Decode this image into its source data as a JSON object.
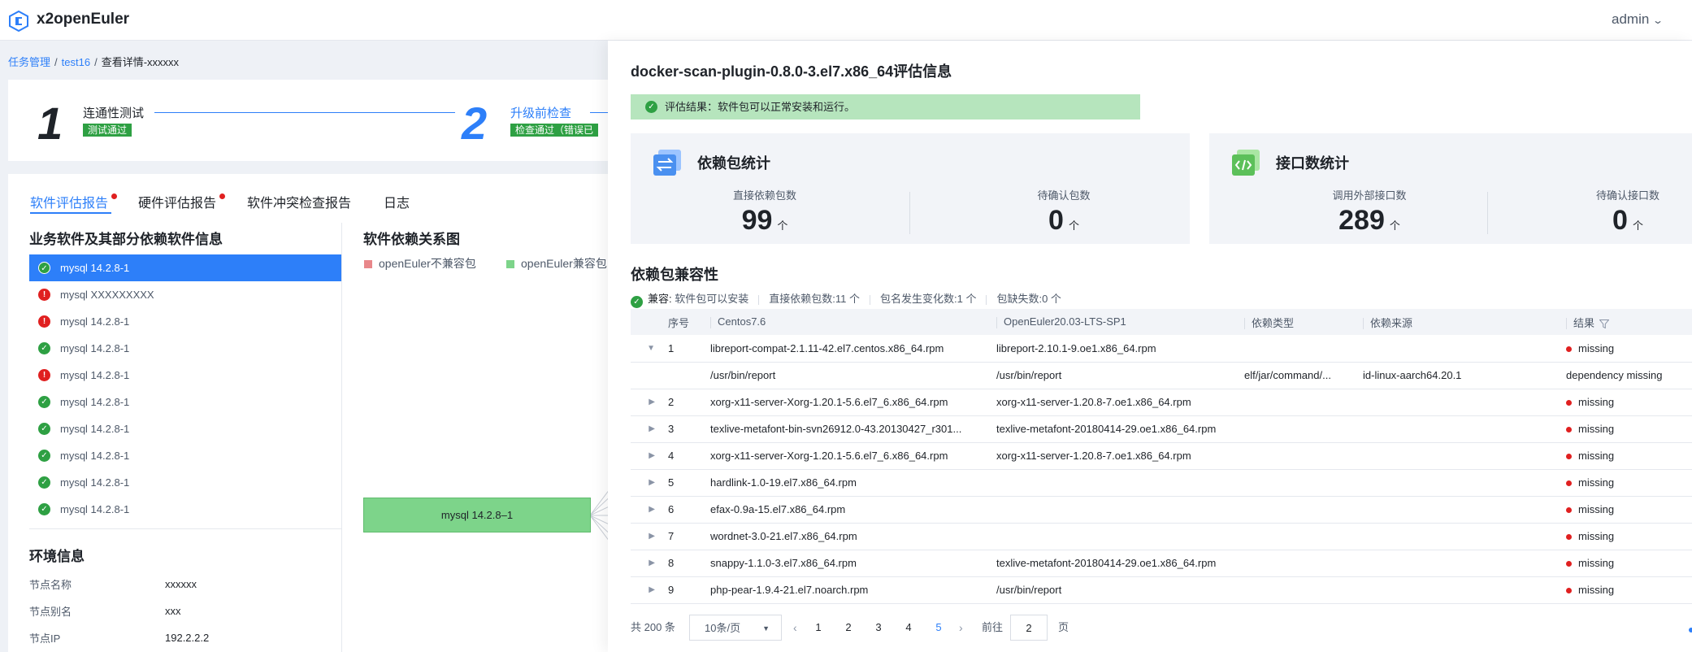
{
  "app": {
    "title": "x2openEuler",
    "user": "admin"
  },
  "breadcrumb": {
    "items": [
      "任务管理",
      "test16"
    ],
    "current": "查看详情-xxxxxx"
  },
  "steps": [
    {
      "number": "1",
      "title": "连通性测试",
      "badge": "测试通过"
    },
    {
      "number": "2",
      "title": "升级前检查",
      "badge": "检查通过（错误已"
    }
  ],
  "tabs": [
    {
      "label": "软件评估报告",
      "dot": true
    },
    {
      "label": "硬件评估报告",
      "dot": true
    },
    {
      "label": "软件冲突检查报告",
      "dot": false
    },
    {
      "label": "日志",
      "dot": false
    }
  ],
  "software": {
    "title": "业务软件及其部分依赖软件信息",
    "items": [
      {
        "label": "mysql 14.2.8-1",
        "status": "ok",
        "selected": true
      },
      {
        "label": "mysql XXXXXXXXX",
        "status": "err",
        "selected": false
      },
      {
        "label": "mysql 14.2.8-1",
        "status": "err",
        "selected": false
      },
      {
        "label": "mysql 14.2.8-1",
        "status": "ok",
        "selected": false
      },
      {
        "label": "mysql 14.2.8-1",
        "status": "err",
        "selected": false
      },
      {
        "label": "mysql 14.2.8-1",
        "status": "ok",
        "selected": false
      },
      {
        "label": "mysql 14.2.8-1",
        "status": "ok",
        "selected": false
      },
      {
        "label": "mysql 14.2.8-1",
        "status": "ok",
        "selected": false
      },
      {
        "label": "mysql 14.2.8-1",
        "status": "ok",
        "selected": false
      },
      {
        "label": "mysql 14.2.8-1",
        "status": "ok",
        "selected": false
      }
    ]
  },
  "env": {
    "title": "环境信息",
    "rows": [
      {
        "label": "节点名称",
        "value": "xxxxxx"
      },
      {
        "label": "节点别名",
        "value": "xxx"
      },
      {
        "label": "节点IP",
        "value": "192.2.2.2"
      }
    ]
  },
  "graph": {
    "title": "软件依赖关系图",
    "legend": [
      {
        "label": "openEuler不兼容包",
        "color": "#e8878a"
      },
      {
        "label": "openEuler兼容包",
        "color": "#7dd48a"
      }
    ],
    "node": "mysql 14.2.8–1"
  },
  "drawer": {
    "title": "docker-scan-plugin-0.8.0-3.el7.x86_64评估信息",
    "result": "评估结果：软件包可以正常安装和运行。",
    "cards": [
      {
        "title": "依赖包统计",
        "stats": [
          {
            "label": "直接依赖包数",
            "value": "99",
            "unit": "个"
          },
          {
            "label": "待确认包数",
            "value": "0",
            "unit": "个"
          }
        ]
      },
      {
        "title": "接口数统计",
        "stats": [
          {
            "label": "调用外部接口数",
            "value": "289",
            "unit": "个"
          },
          {
            "label": "待确认接口数",
            "value": "0",
            "unit": "个"
          }
        ]
      }
    ],
    "compat": {
      "title": "依赖包兼容性",
      "summary_label": "兼容:",
      "summary_text": "软件包可以安装",
      "direct_deps": "直接依赖包数:11 个",
      "name_changed": "包名发生变化数:1 个",
      "missing": "包缺失数:0 个"
    },
    "table": {
      "columns": [
        "序号",
        "Centos7.6",
        "OpenEuler20.03-LTS-SP1",
        "依赖类型",
        "依赖来源",
        "结果"
      ],
      "rows": [
        {
          "toggle": "▼",
          "index": "1",
          "centos": "libreport-compat-2.1.11-42.el7.centos.x86_64.rpm",
          "openeuler": "libreport-2.10.1-9.oe1.x86_64.rpm",
          "type": "",
          "source": "",
          "result": "missing",
          "dot": true
        },
        {
          "toggle": "",
          "index": "",
          "centos": "/usr/bin/report",
          "openeuler": "/usr/bin/report",
          "type": "elf/jar/command/...",
          "source": "id-linux-aarch64.20.1",
          "result": "dependency missing",
          "dot": false
        },
        {
          "toggle": "▶",
          "index": "2",
          "centos": "xorg-x11-server-Xorg-1.20.1-5.6.el7_6.x86_64.rpm",
          "openeuler": "xorg-x11-server-1.20.8-7.oe1.x86_64.rpm",
          "type": "",
          "source": "",
          "result": "missing",
          "dot": true
        },
        {
          "toggle": "▶",
          "index": "3",
          "centos": "texlive-metafont-bin-svn26912.0-43.20130427_r301...",
          "openeuler": "texlive-metafont-20180414-29.oe1.x86_64.rpm",
          "type": "",
          "source": "",
          "result": "missing",
          "dot": true
        },
        {
          "toggle": "▶",
          "index": "4",
          "centos": "xorg-x11-server-Xorg-1.20.1-5.6.el7_6.x86_64.rpm",
          "openeuler": "xorg-x11-server-1.20.8-7.oe1.x86_64.rpm",
          "type": "",
          "source": "",
          "result": "missing",
          "dot": true
        },
        {
          "toggle": "▶",
          "index": "5",
          "centos": "hardlink-1.0-19.el7.x86_64.rpm",
          "openeuler": "",
          "type": "",
          "source": "",
          "result": "missing",
          "dot": true
        },
        {
          "toggle": "▶",
          "index": "6",
          "centos": "efax-0.9a-15.el7.x86_64.rpm",
          "openeuler": "",
          "type": "",
          "source": "",
          "result": "missing",
          "dot": true
        },
        {
          "toggle": "▶",
          "index": "7",
          "centos": "wordnet-3.0-21.el7.x86_64.rpm",
          "openeuler": "",
          "type": "",
          "source": "",
          "result": "missing",
          "dot": true
        },
        {
          "toggle": "▶",
          "index": "8",
          "centos": "snappy-1.1.0-3.el7.x86_64.rpm",
          "openeuler": "texlive-metafont-20180414-29.oe1.x86_64.rpm",
          "type": "",
          "source": "",
          "result": "missing",
          "dot": true
        },
        {
          "toggle": "▶",
          "index": "9",
          "centos": "php-pear-1.9.4-21.el7.noarch.rpm",
          "openeuler": "/usr/bin/report",
          "type": "",
          "source": "",
          "result": "missing",
          "dot": true
        }
      ]
    },
    "pagination": {
      "total": "共 200 条",
      "page_size": "10条/页",
      "prev": "‹",
      "pages": [
        "1",
        "2",
        "3",
        "4",
        "5"
      ],
      "current": "5",
      "next": "›",
      "goto_label": "前往",
      "goto_value": "2",
      "goto_suffix": "页"
    }
  },
  "colors": {
    "primary": "#2d7ff9",
    "success": "#2ea043",
    "error": "#e02020",
    "result_bg": "#b6e5bd"
  }
}
